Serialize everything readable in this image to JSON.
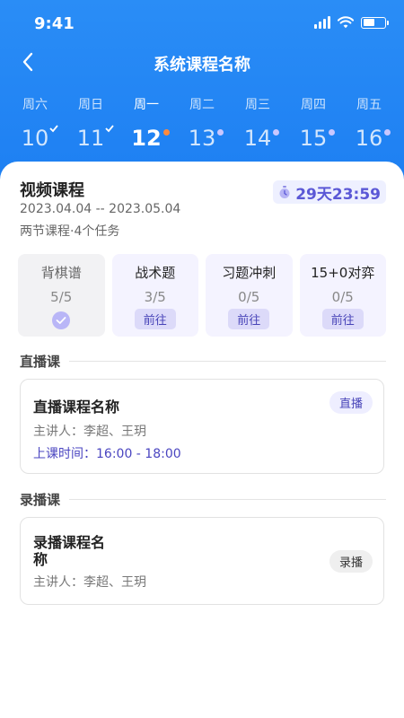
{
  "status_bar": {
    "time": "9:41"
  },
  "nav": {
    "title": "系统课程名称"
  },
  "week": [
    {
      "name": "周六",
      "num": "10",
      "state": "checked"
    },
    {
      "name": "周日",
      "num": "11",
      "state": "checked"
    },
    {
      "name": "周一",
      "num": "12",
      "state": "today"
    },
    {
      "name": "周二",
      "num": "13",
      "state": "pending"
    },
    {
      "name": "周三",
      "num": "14",
      "state": "pending"
    },
    {
      "name": "周四",
      "num": "15",
      "state": "pending"
    },
    {
      "name": "周五",
      "num": "16",
      "state": "pending"
    }
  ],
  "course": {
    "title": "视频课程",
    "countdown": "29天23:59",
    "date_range": "2023.04.04 -- 2023.05.04",
    "summary": "两节课程·4个任务"
  },
  "tasks": [
    {
      "name": "背棋谱",
      "progress": "5/5",
      "done": true
    },
    {
      "name": "战术题",
      "progress": "3/5",
      "action": "前往"
    },
    {
      "name": "习题冲刺",
      "progress": "0/5",
      "action": "前往"
    },
    {
      "name": "15+0对弈",
      "progress": "0/5",
      "action": "前往"
    }
  ],
  "live_section": {
    "title": "直播课",
    "lesson": {
      "name": "直播课程名称",
      "teacher": "主讲人：李超、王玥",
      "time": "上课时间：16:00 - 18:00",
      "tag": "直播"
    }
  },
  "recorded_section": {
    "title": "录播课",
    "lesson": {
      "name_line1": "录播课程名",
      "name_line2": "称",
      "teacher": "主讲人：李超、王玥",
      "tag": "录播"
    }
  },
  "colors": {
    "primary": "#1d7ff2",
    "accent": "#5b58d6",
    "today_dot": "#ff8a3d"
  }
}
